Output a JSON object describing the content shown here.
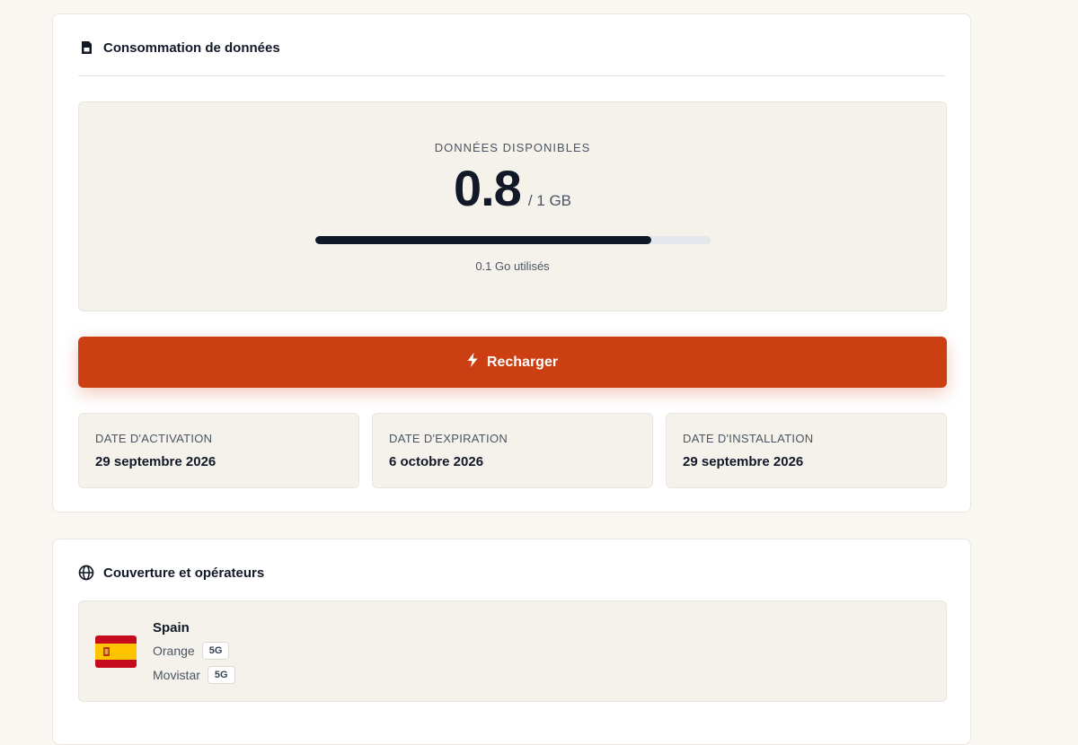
{
  "usage_card": {
    "title": "Consommation de données",
    "icon": "sim-card-icon",
    "available_label": "DONNÉES DISPONIBLES",
    "available_value": "0.8",
    "total": "/ 1 GB",
    "progress_fraction": 0.85,
    "used_text": "0.1 Go utilisés",
    "recharge_label": "Recharger",
    "recharge_icon": "lightning-icon",
    "dates": [
      {
        "label": "DATE D'ACTIVATION",
        "value": "29 septembre 2026"
      },
      {
        "label": "DATE D'EXPIRATION",
        "value": "6 octobre 2026"
      },
      {
        "label": "DATE D'INSTALLATION",
        "value": "29 septembre 2026"
      }
    ]
  },
  "coverage_card": {
    "title": "Couverture et opérateurs",
    "icon": "globe-icon",
    "countries": [
      {
        "name": "Spain",
        "flag_icon": "spain-flag-icon",
        "operators": [
          {
            "name": "Orange",
            "network": "5G"
          },
          {
            "name": "Movistar",
            "network": "5G"
          }
        ]
      }
    ]
  },
  "colors": {
    "accent": "#cc3f12",
    "background": "#f9f7f2",
    "panel": "#f5f2ec",
    "text": "#111827"
  }
}
